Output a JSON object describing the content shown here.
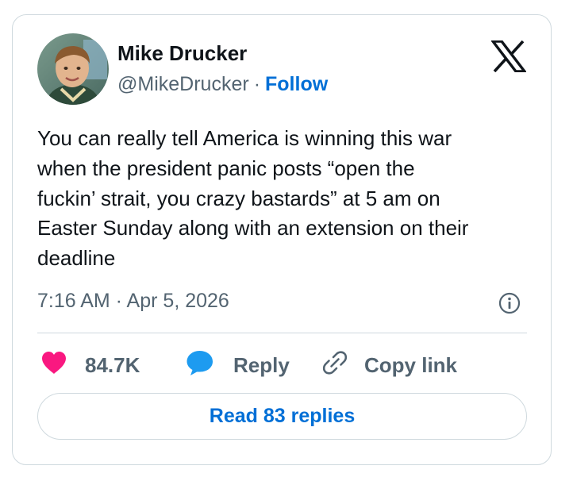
{
  "author": {
    "name": "Mike Drucker",
    "handle": "@MikeDrucker",
    "separator": "·",
    "follow_label": "Follow"
  },
  "tweet": {
    "text": "You can really tell America is winning this war\nwhen the president panic posts “open the\nfuckin’ strait, you crazy bastards” at 5 am on\nEaster Sunday along with an extension on their\ndeadline",
    "timestamp": "7:16 AM · Apr 5, 2026"
  },
  "actions": {
    "like_count": "84.7K",
    "reply_label": "Reply",
    "copy_link_label": "Copy link"
  },
  "read_replies_label": "Read 83 replies",
  "icons": {
    "avatar": "profile-photo",
    "logo": "x-logo-icon",
    "info": "info-icon",
    "like": "heart-icon",
    "reply": "speech-bubble-icon",
    "copy": "link-icon"
  },
  "colors": {
    "accent": "#006fd6",
    "heart": "#f91880",
    "reply_bubble": "#1d9bf0",
    "text": "#0f1419",
    "muted": "#536471",
    "border": "#cfd9de"
  }
}
